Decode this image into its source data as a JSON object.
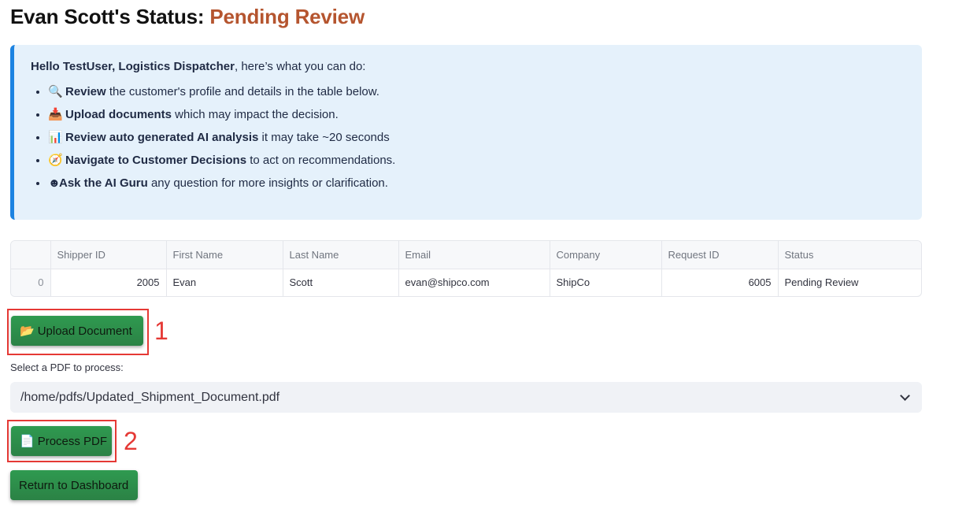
{
  "header": {
    "title_prefix": "Evan Scott's Status: ",
    "title_status": "Pending Review"
  },
  "info": {
    "greeting_bold": "Hello TestUser, Logistics Dispatcher",
    "greeting_rest": ", here’s what you can do:",
    "items": [
      {
        "icon": "🔍",
        "icon_name": "magnifier-icon",
        "bold": "Review",
        "text": " the customer's profile and details in the table below."
      },
      {
        "icon": "📥",
        "icon_name": "inbox-tray-icon",
        "bold": "Upload documents",
        "text": " which may impact the decision."
      },
      {
        "icon": "📊",
        "icon_name": "bar-chart-icon",
        "bold": "Review auto generated AI analysis",
        "text": " it may take ~20 seconds"
      },
      {
        "icon": "🧭",
        "icon_name": "compass-icon",
        "bold": "Navigate to Customer Decisions",
        "text": " to act on recommendations."
      },
      {
        "icon": "☻",
        "icon_name": "guru-face-icon",
        "bold": "Ask the AI Guru",
        "text": " any question for more insights or clarification."
      }
    ]
  },
  "table": {
    "columns": [
      "",
      "Shipper ID",
      "First Name",
      "Last Name",
      "Email",
      "Company",
      "Request ID",
      "Status"
    ],
    "rows": [
      [
        "0",
        "2005",
        "Evan",
        "Scott",
        "evan@shipco.com",
        "ShipCo",
        "6005",
        "Pending Review"
      ]
    ]
  },
  "upload": {
    "icon": "📂",
    "label": "Upload Document",
    "annotation": "1"
  },
  "select": {
    "label": "Select a PDF to process:",
    "value": "/home/pdfs/Updated_Shipment_Document.pdf"
  },
  "process": {
    "icon": "📄",
    "label": "Process PDF",
    "annotation": "2"
  },
  "dashboard": {
    "label": "Return to Dashboard"
  },
  "colors": {
    "status_accent": "#b5552f",
    "info_bg": "#e5f1fb",
    "info_border": "#1c83e1",
    "button_green": "#2e8b49",
    "annotation_red": "#e53935"
  }
}
